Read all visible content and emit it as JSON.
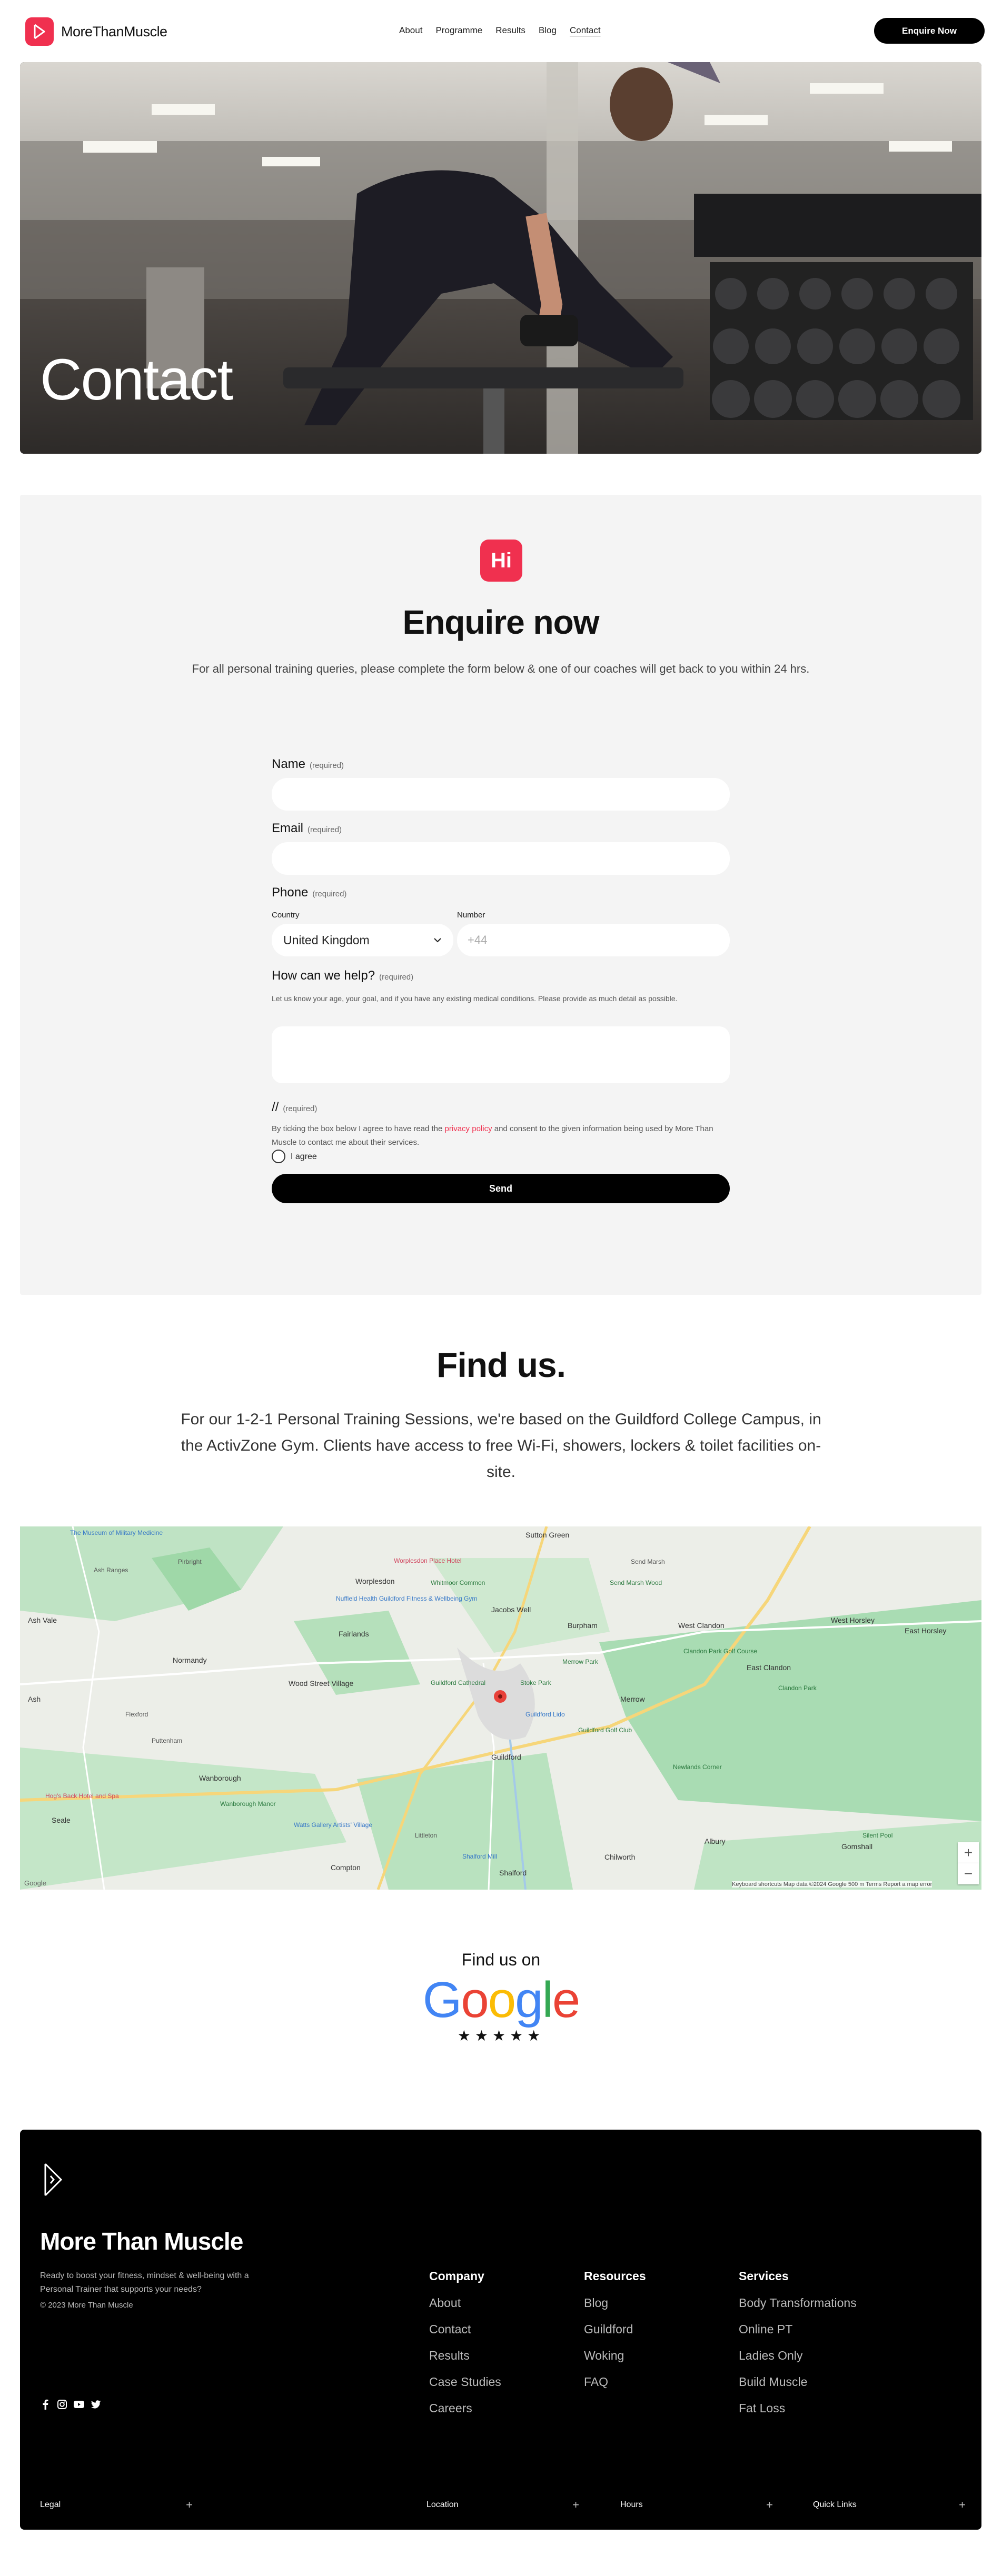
{
  "header": {
    "brand": "MoreThanMuscle",
    "nav": [
      "About",
      "Programme",
      "Results",
      "Blog",
      "Contact"
    ],
    "active_nav": "Contact",
    "cta": "Enquire Now"
  },
  "hero": {
    "title": "Contact"
  },
  "enquire": {
    "badge": "Hi",
    "title": "Enquire now",
    "subtitle": "For all personal training queries, please complete the form below & one of our coaches will get back to you within 24 hrs.",
    "required_tag": "(required)",
    "name_label": "Name",
    "email_label": "Email",
    "phone_label": "Phone",
    "country_label": "Country",
    "country_value": "United Kingdom",
    "number_label": "Number",
    "number_placeholder": "+44",
    "help_label": "How can we help?",
    "help_hint": "Let us know your age, your goal, and if you have any existing medical conditions. Please provide as much detail as possible.",
    "consent_label": "//",
    "consent_before": "By ticking the box below I agree to have read the ",
    "consent_link": "privacy policy",
    "consent_after": " and consent to the given information being used by More Than Muscle to contact me about their services.",
    "agree_label": "I agree",
    "send": "Send"
  },
  "find": {
    "title": "Find us.",
    "text": "For our 1-2-1 Personal Training Sessions, we're based on the Guildford College Campus, in the ActivZone Gym. Clients have access to free Wi-Fi, showers, lockers & toilet facilities on-site."
  },
  "map": {
    "places": [
      "Worplesdon",
      "Jacobs Well",
      "Guildford",
      "Merrow",
      "Burpham",
      "West Clandon",
      "East Clandon",
      "West Horsley",
      "East Horsley",
      "Fairlands",
      "Wood Street Village",
      "Normandy",
      "Ash",
      "Ash Vale",
      "Ash Ranges",
      "Wanborough",
      "Seale",
      "Compton",
      "Shalford",
      "Chilworth",
      "Albury",
      "Gomshall",
      "Sutton Green",
      "Littleton",
      "Puttenham",
      "Flexford",
      "Send Marsh",
      "Pirbright"
    ],
    "pois": [
      "The Museum of Military Medicine",
      "Worplesdon Place Hotel",
      "Nuffield Health Guildford Fitness & Wellbeing Gym",
      "Guildford Cathedral",
      "Clandon Park Golf Course",
      "Merrow Park",
      "Guildford Golf Club",
      "Newlands Corner",
      "Stoke Park",
      "Hog's Back Hotel and Spa",
      "Watts Gallery Artists' Village",
      "Shalford Mill",
      "Silent Pool",
      "Clandon Park",
      "Guildford Lido",
      "Send Marsh Wood",
      "Whitmoor Common",
      "Wanborough Manor"
    ],
    "zoom_in": "+",
    "zoom_out": "−",
    "google_logo": "Google",
    "footer": "Keyboard shortcuts   Map data ©2024 Google   500 m   Terms   Report a map error"
  },
  "findon": {
    "label": "Find us on",
    "brand": "Google",
    "stars": "★★★★★"
  },
  "footer": {
    "brand": "More Than Muscle",
    "desc": "Ready to boost your fitness, mindset & well-being with a Personal Trainer that supports your needs?",
    "copyright": "© 2023 More Than Muscle",
    "columns": [
      {
        "title": "Company",
        "links": [
          "About",
          "Contact",
          "Results",
          "Case Studies",
          "Careers"
        ]
      },
      {
        "title": "Resources",
        "links": [
          "Blog",
          "Guildford",
          "Woking",
          "FAQ"
        ]
      },
      {
        "title": "Services",
        "links": [
          "Body Transformations",
          "Online PT",
          "Ladies Only",
          "Build Muscle",
          "Fat Loss"
        ]
      }
    ],
    "bottom": [
      "Legal",
      "Location",
      "Hours",
      "Quick Links"
    ],
    "plus": "+"
  },
  "colors": {
    "accent": "#f0304f",
    "footer_bg": "#000000",
    "section_bg": "#f4f4f4"
  }
}
